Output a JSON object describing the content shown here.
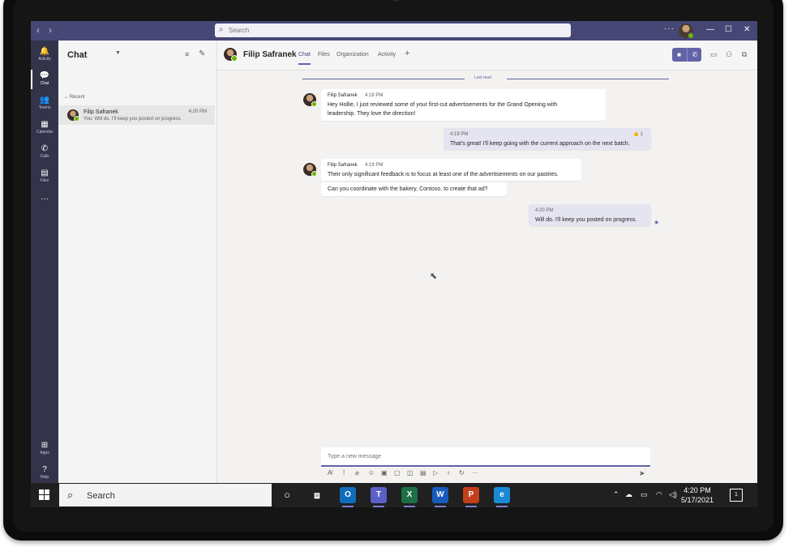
{
  "titlebar": {
    "back": "‹",
    "forward": "›",
    "search_placeholder": "Search",
    "more": "···",
    "minimize": "—",
    "maximize": "☐",
    "close": "✕"
  },
  "rail": [
    {
      "label": "Activity",
      "icon": "bell-icon",
      "glyph": "🔔"
    },
    {
      "label": "Chat",
      "icon": "chat-icon",
      "glyph": "💬"
    },
    {
      "label": "Teams",
      "icon": "teams-icon",
      "glyph": "👥"
    },
    {
      "label": "Calendar",
      "icon": "calendar-icon",
      "glyph": "▦"
    },
    {
      "label": "Calls",
      "icon": "phone-icon",
      "glyph": "✆"
    },
    {
      "label": "Files",
      "icon": "file-icon",
      "glyph": "▤"
    },
    {
      "label": "",
      "icon": "more-icon",
      "glyph": "···"
    },
    {
      "label": "Apps",
      "icon": "apps-icon",
      "glyph": "⊞"
    },
    {
      "label": "Help",
      "icon": "help-icon",
      "glyph": "?"
    }
  ],
  "chatlist": {
    "title": "Chat",
    "section": "Recent",
    "items": [
      {
        "name": "Filip Safranek",
        "time": "4:20 PM",
        "preview": "You: Will do. I'll keep you posted on progress."
      }
    ]
  },
  "conversation": {
    "name": "Filip Safranek",
    "tabs": [
      "Chat",
      "Files",
      "Organization",
      "Activity"
    ],
    "last_read": "Last read",
    "messages": [
      {
        "author": "Filip Safranek",
        "time": "4:18 PM",
        "lines": [
          "Hey Hollie, I just reviewed some of your first-cut advertisements for the Grand Opening with",
          "leadership. They love the direction!"
        ]
      },
      {
        "time": "4:19 PM",
        "reaction": "👍 1",
        "lines": [
          "That's great! I'll keep going with the current approach on the next batch."
        ]
      },
      {
        "author": "Filip Safranek",
        "time": "4:19 PM",
        "lines": [
          "Their only significant feedback is to focus at least one of the advertisements on our pastries."
        ]
      },
      {
        "lines": [
          "Can you coordinate with the bakery, Contoso, to create that ad?"
        ]
      },
      {
        "time": "4:20 PM",
        "lines": [
          "Will do. I'll keep you posted on progress."
        ]
      }
    ],
    "compose_placeholder": "Type a new message"
  },
  "taskbar": {
    "search": "Search",
    "time": "4:20 PM",
    "date": "5/17/2021",
    "apps": [
      {
        "name": "outlook-icon",
        "glyph": "O",
        "color": "#0f6cbd"
      },
      {
        "name": "teams-app-icon",
        "glyph": "T",
        "color": "#5b5fc7"
      },
      {
        "name": "excel-icon",
        "glyph": "X",
        "color": "#1d7044"
      },
      {
        "name": "word-icon",
        "glyph": "W",
        "color": "#185abd"
      },
      {
        "name": "powerpoint-icon",
        "glyph": "P",
        "color": "#c43e1c"
      },
      {
        "name": "edge-icon",
        "glyph": "e",
        "color": "#1a8ad4"
      }
    ]
  },
  "colors": {
    "brand": "#6264a7",
    "titlebar": "#464775",
    "rail": "#33344a",
    "presence": "#6bb700"
  }
}
